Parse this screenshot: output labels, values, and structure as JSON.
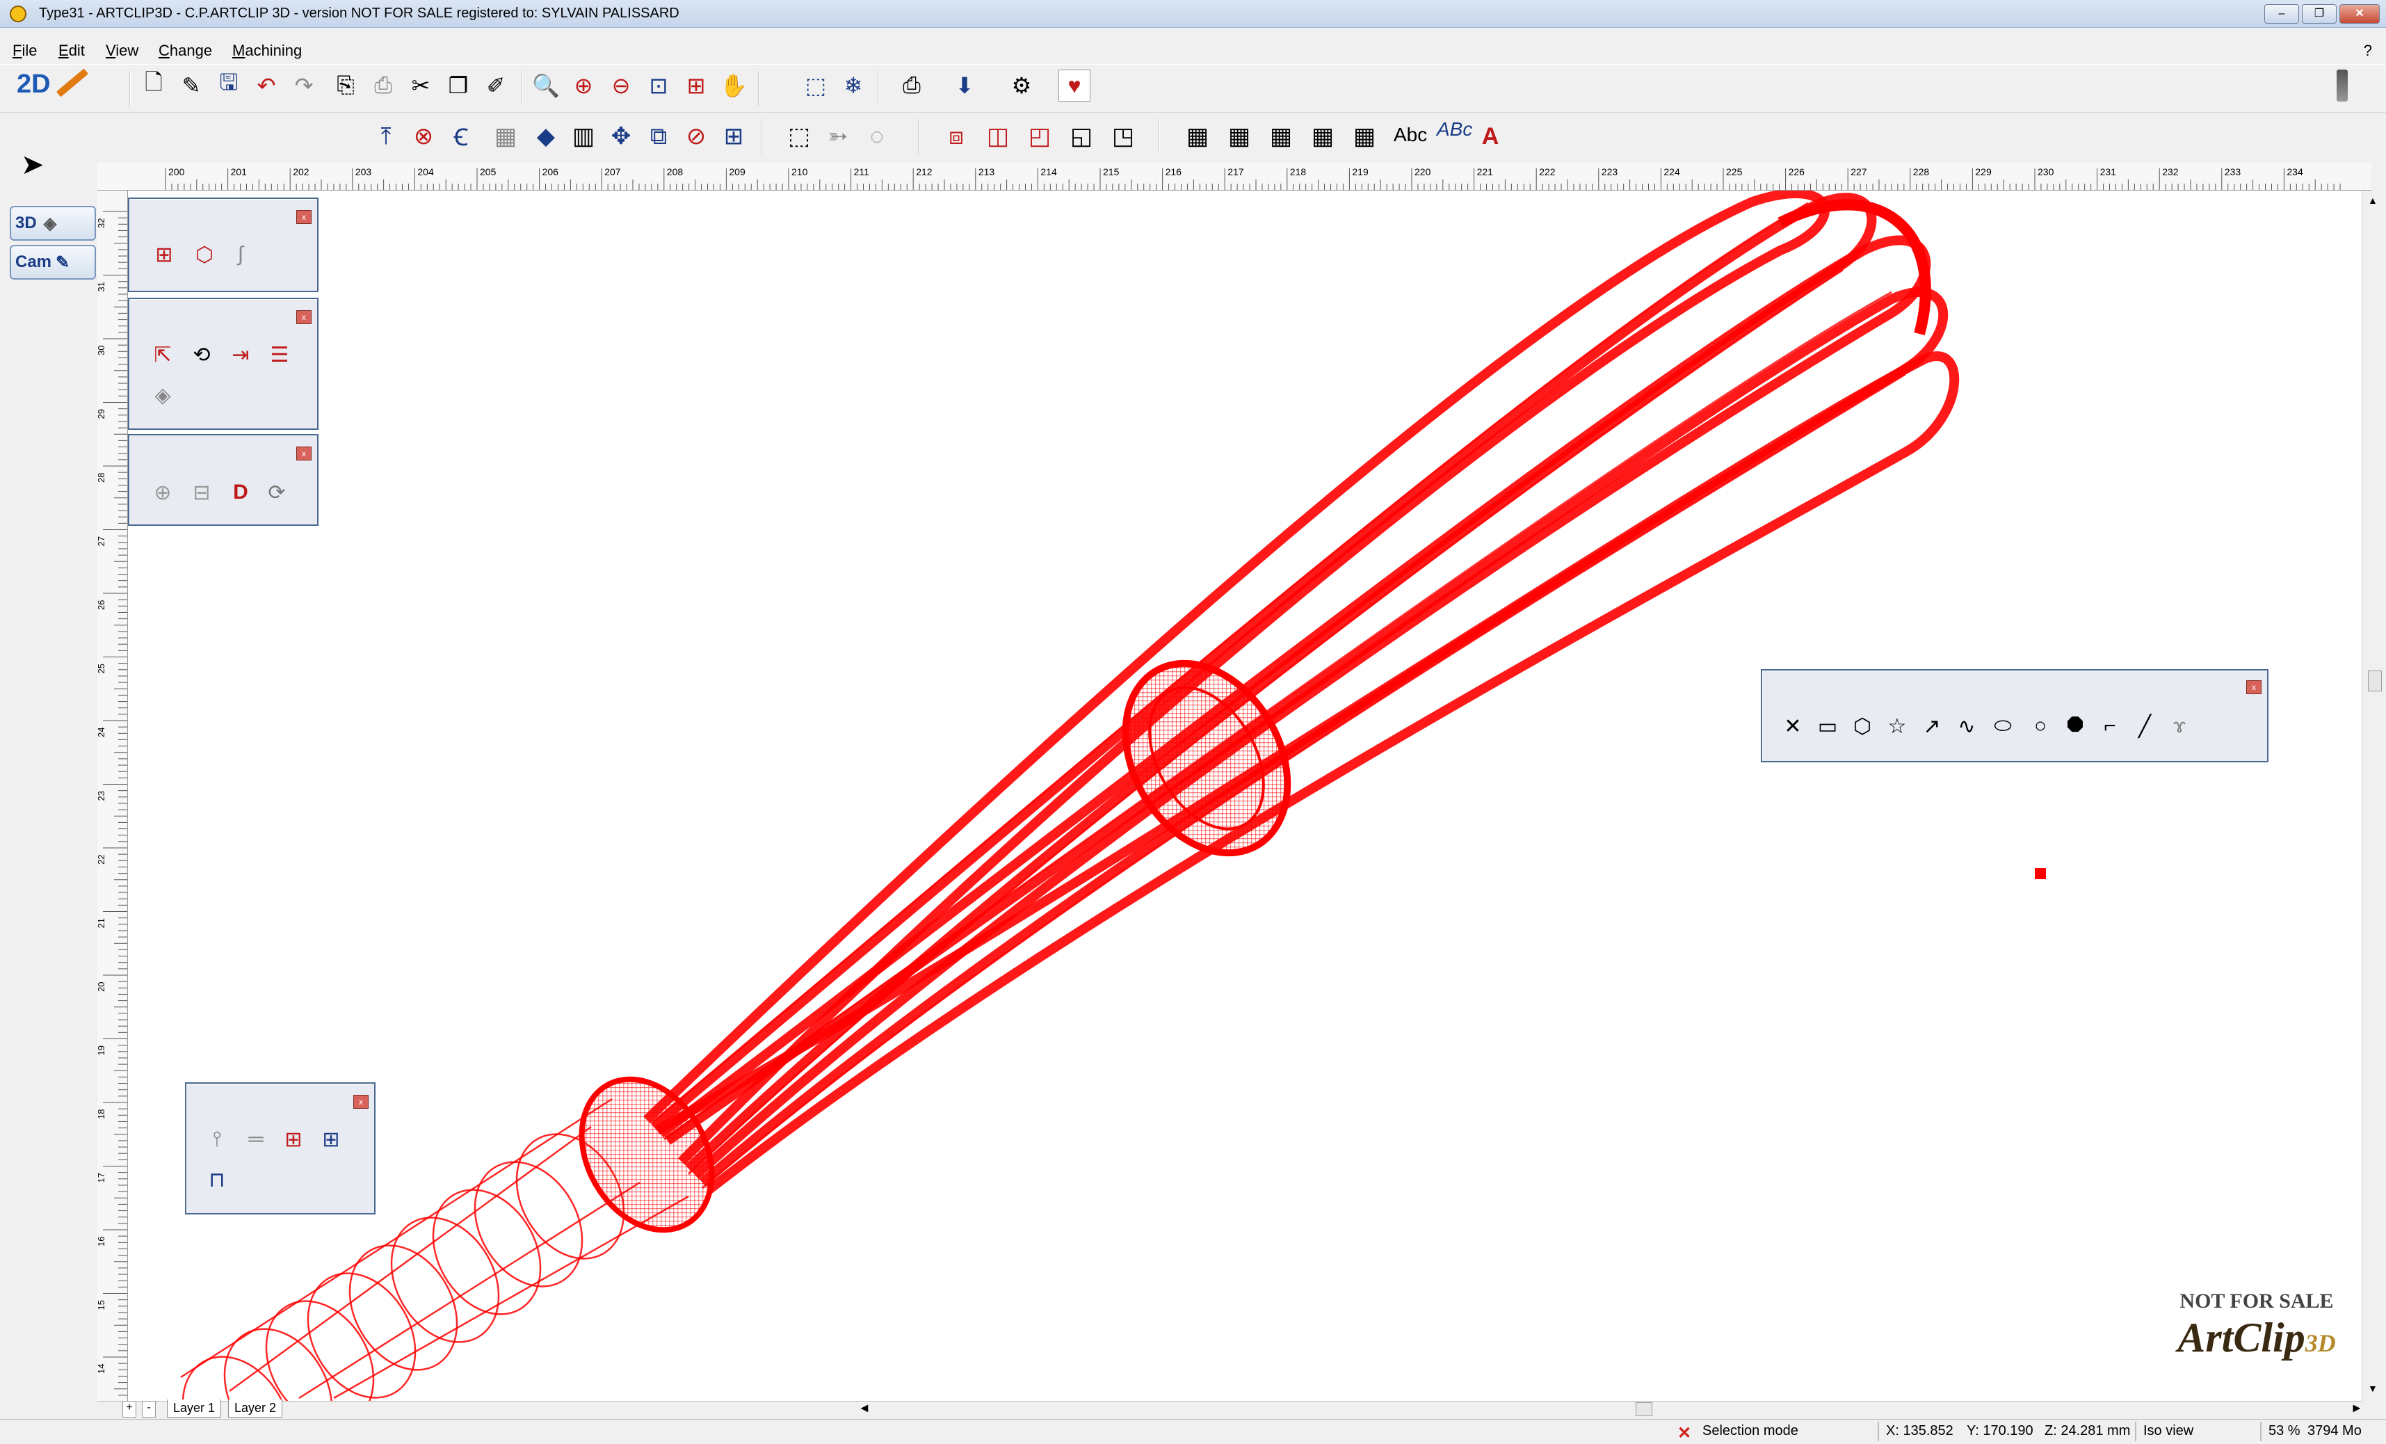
{
  "window": {
    "title": "Type31 - ARTCLIP3D  - C.P.ARTCLIP 3D - version NOT FOR SALE registered to: SYLVAIN PALISSARD",
    "minimize": "–",
    "restore": "❐",
    "close": "✕"
  },
  "menu": {
    "items": [
      {
        "label": "File",
        "u": "F",
        "rest": "ile"
      },
      {
        "label": "Edit",
        "u": "E",
        "rest": "dit"
      },
      {
        "label": "View",
        "u": "V",
        "rest": "iew"
      },
      {
        "label": "Change",
        "u": "C",
        "rest": "hange"
      },
      {
        "label": "Machining",
        "u": "M",
        "rest": "achining"
      }
    ],
    "help": "?"
  },
  "mode_badge": "2D",
  "mode_tabs": {
    "three_d": "3D",
    "cam": "Cam"
  },
  "ruler": {
    "top_labels": [
      "200",
      "201",
      "202",
      "203",
      "204",
      "205",
      "206",
      "207",
      "208",
      "209",
      "210",
      "211",
      "212",
      "213",
      "214",
      "215",
      "216",
      "217",
      "218",
      "219",
      "220",
      "221",
      "222",
      "223",
      "224",
      "225",
      "226",
      "227",
      "228",
      "229",
      "230",
      "231",
      "232",
      "233",
      "234"
    ],
    "left_labels": [
      "32",
      "31",
      "30",
      "29",
      "28",
      "27",
      "26",
      "25",
      "24",
      "23",
      "22",
      "21",
      "20",
      "19",
      "18",
      "17",
      "16",
      "15",
      "14"
    ]
  },
  "text_tools": {
    "abc": "Abc",
    "spell": "ABc"
  },
  "layers": {
    "add": "+",
    "remove": "-",
    "tabs": [
      "Layer 1",
      "Layer 2"
    ]
  },
  "status": {
    "mode": "Selection mode",
    "x": "X: 135.852",
    "y": "Y: 170.190",
    "z": "Z: 24.281 mm",
    "view": "Iso view",
    "zoom": "53 %",
    "memory": "3794 Mo"
  },
  "watermark": {
    "line1": "NOT FOR SALE",
    "logo": "ArtClip",
    "logo_suffix": "3D"
  },
  "colors": {
    "accent": "#ff0000",
    "panel_border": "#4a6890",
    "titlebar": "#c5d5ea"
  }
}
